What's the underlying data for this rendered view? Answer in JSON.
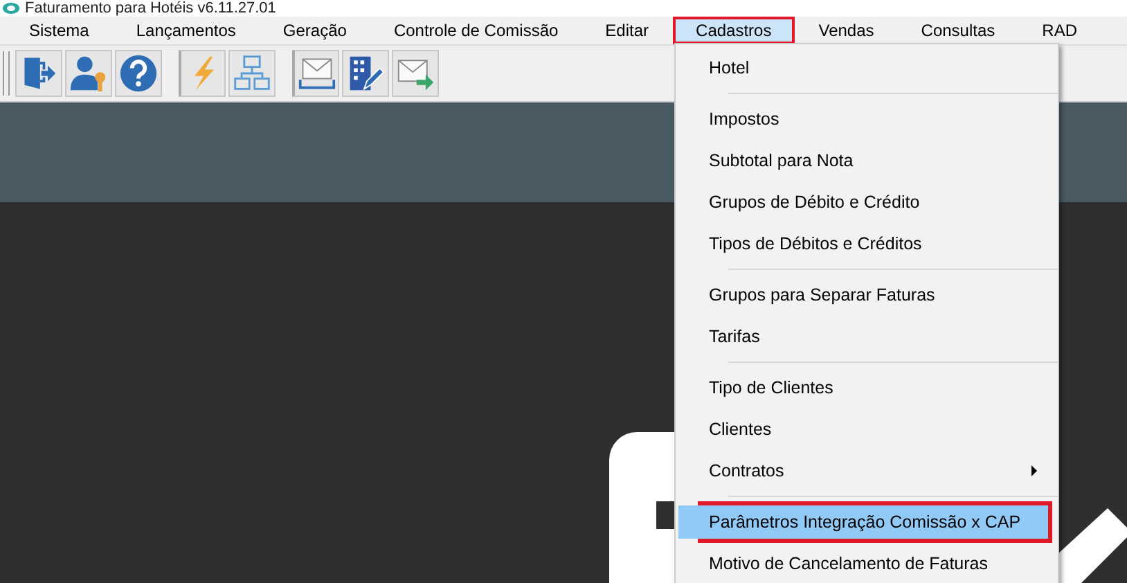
{
  "window": {
    "title": "Faturamento para Hotéis v6.11.27.01"
  },
  "menubar": [
    {
      "label": "Sistema",
      "selected": false,
      "outlined": false
    },
    {
      "label": "Lançamentos",
      "selected": false,
      "outlined": false
    },
    {
      "label": "Geração",
      "selected": false,
      "outlined": false
    },
    {
      "label": "Controle de Comissão",
      "selected": false,
      "outlined": false
    },
    {
      "label": "Editar",
      "selected": false,
      "outlined": false
    },
    {
      "label": "Cadastros",
      "selected": true,
      "outlined": true
    },
    {
      "label": "Vendas",
      "selected": false,
      "outlined": false
    },
    {
      "label": "Consultas",
      "selected": false,
      "outlined": false
    },
    {
      "label": "RAD",
      "selected": false,
      "outlined": false
    }
  ],
  "toolbar": [
    {
      "kind": "exit",
      "group_start": false
    },
    {
      "kind": "user-key",
      "group_start": false
    },
    {
      "kind": "help",
      "group_start": false
    },
    {
      "kind": "lightning",
      "group_start": true
    },
    {
      "kind": "org-chart",
      "group_start": false
    },
    {
      "kind": "mail-tray",
      "group_start": true
    },
    {
      "kind": "building-edit",
      "group_start": false
    },
    {
      "kind": "mail-send",
      "group_start": false
    }
  ],
  "dropdown": [
    {
      "kind": "item",
      "label": "Hotel",
      "selected": false,
      "outlined": false,
      "submenu": false
    },
    {
      "kind": "separator"
    },
    {
      "kind": "item",
      "label": "Impostos",
      "selected": false,
      "outlined": false,
      "submenu": false
    },
    {
      "kind": "item",
      "label": "Subtotal para Nota",
      "selected": false,
      "outlined": false,
      "submenu": false
    },
    {
      "kind": "item",
      "label": "Grupos de Débito e Crédito",
      "selected": false,
      "outlined": false,
      "submenu": false
    },
    {
      "kind": "item",
      "label": "Tipos de Débitos e Créditos",
      "selected": false,
      "outlined": false,
      "submenu": false
    },
    {
      "kind": "separator"
    },
    {
      "kind": "item",
      "label": "Grupos para Separar Faturas",
      "selected": false,
      "outlined": false,
      "submenu": false
    },
    {
      "kind": "item",
      "label": "Tarifas",
      "selected": false,
      "outlined": false,
      "submenu": false
    },
    {
      "kind": "separator"
    },
    {
      "kind": "item",
      "label": "Tipo de Clientes",
      "selected": false,
      "outlined": false,
      "submenu": false
    },
    {
      "kind": "item",
      "label": "Clientes",
      "selected": false,
      "outlined": false,
      "submenu": false
    },
    {
      "kind": "item",
      "label": "Contratos",
      "selected": false,
      "outlined": false,
      "submenu": true
    },
    {
      "kind": "separator"
    },
    {
      "kind": "item",
      "label": "Parâmetros Integração Comissão x CAP",
      "selected": true,
      "outlined": true,
      "submenu": false
    },
    {
      "kind": "item",
      "label": "Motivo de Cancelamento de Faturas",
      "selected": false,
      "outlined": false,
      "submenu": false
    }
  ]
}
